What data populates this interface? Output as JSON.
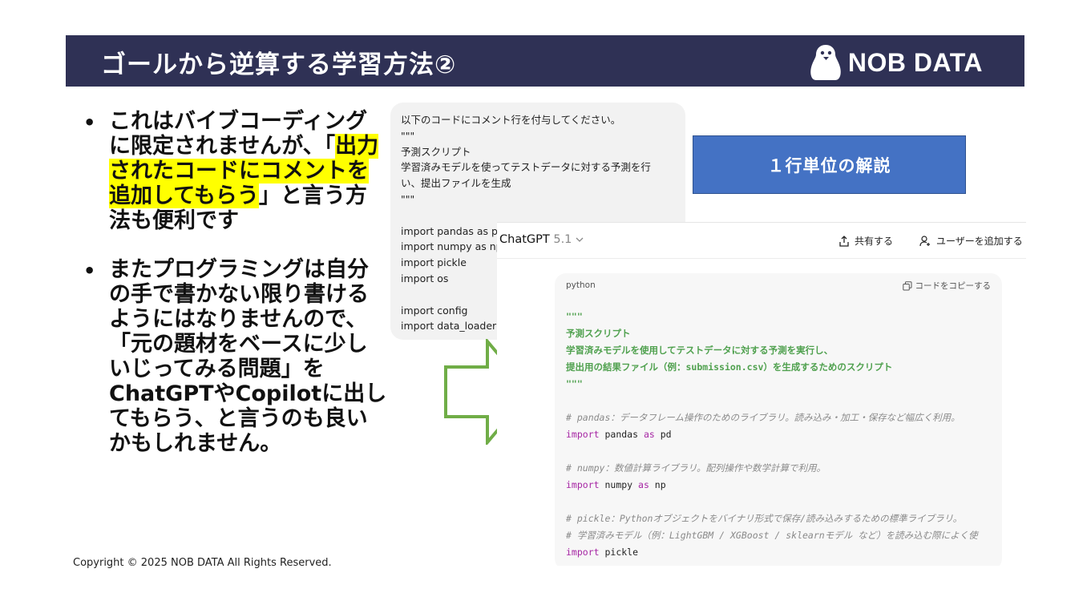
{
  "slide": {
    "title": "ゴールから逆算する学習方法②",
    "logo_text": "NOB DATA",
    "bullets": [
      {
        "before": "これはバイブコーディングに限定されませんが、「",
        "highlight": "出力されたコードにコメントを追加してもらう",
        "after": "」と言う方法も便利です"
      },
      {
        "text": "またプログラミングは自分の手で書かない限り書けるようにはなりませんので、「元の題材をベースに少しいじってみる問題」をChatGPTやCopilotに出してもらう、と言うのも良いかもしれません。"
      }
    ],
    "copyright": "Copyright © 2025 NOB DATA All Rights Reserved.",
    "callout": "１行単位の解説"
  },
  "prompt": {
    "lines": [
      "以下のコードにコメント行を付与してください。",
      "\"\"\"",
      "予測スクリプト",
      "学習済みモデルを使ってテストデータに対する予測を行",
      "い、提出ファイルを生成",
      "\"\"\"",
      "",
      "import pandas as pd",
      "import numpy as np",
      "import pickle",
      "import os",
      "",
      "import config",
      "import data_loader"
    ]
  },
  "chat": {
    "model_name": "ChatGPT",
    "model_version": "5.1",
    "share_label": "共有する",
    "add_user_label": "ユーザーを追加する",
    "code_lang": "python",
    "copy_label": "コードをコピーする",
    "code_lines": [
      {
        "type": "doc",
        "text": "\"\"\""
      },
      {
        "type": "doc",
        "text": "予測スクリプト"
      },
      {
        "type": "doc",
        "text": "学習済みモデルを使用してテストデータに対する予測を実行し、"
      },
      {
        "type": "doc",
        "text": "提出用の結果ファイル（例：submission.csv）を生成するためのスクリプト"
      },
      {
        "type": "doc",
        "text": "\"\"\""
      },
      {
        "type": "blank",
        "text": ""
      },
      {
        "type": "comment",
        "text": "# pandas：データフレーム操作のためのライブラリ。読み込み・加工・保存など幅広く利用。"
      },
      {
        "type": "import",
        "parts": [
          "import",
          " pandas ",
          "as",
          " pd"
        ]
      },
      {
        "type": "blank",
        "text": ""
      },
      {
        "type": "comment",
        "text": "# numpy：数値計算ライブラリ。配列操作や数学計算で利用。"
      },
      {
        "type": "import",
        "parts": [
          "import",
          " numpy ",
          "as",
          " np"
        ]
      },
      {
        "type": "blank",
        "text": ""
      },
      {
        "type": "comment",
        "text": "# pickle：Pythonオブジェクトをバイナリ形式で保存/読み込みするための標準ライブラリ。"
      },
      {
        "type": "comment",
        "text": "# 学習済みモデル（例：LightGBM / XGBoost / sklearnモデル など）を読み込む際によく使"
      },
      {
        "type": "import",
        "parts": [
          "import",
          " pickle"
        ]
      }
    ]
  },
  "colors": {
    "header_bg": "#2f3155",
    "highlight": "#ffff00",
    "callout_bg": "#4472c4",
    "arrow": "#70ad47",
    "docstring": "#50a14f",
    "keyword": "#a626a4"
  },
  "icons": [
    "penguin-logo-icon",
    "share-icon",
    "add-user-icon",
    "copy-icon",
    "chevron-down-icon",
    "right-arrow-shape"
  ]
}
